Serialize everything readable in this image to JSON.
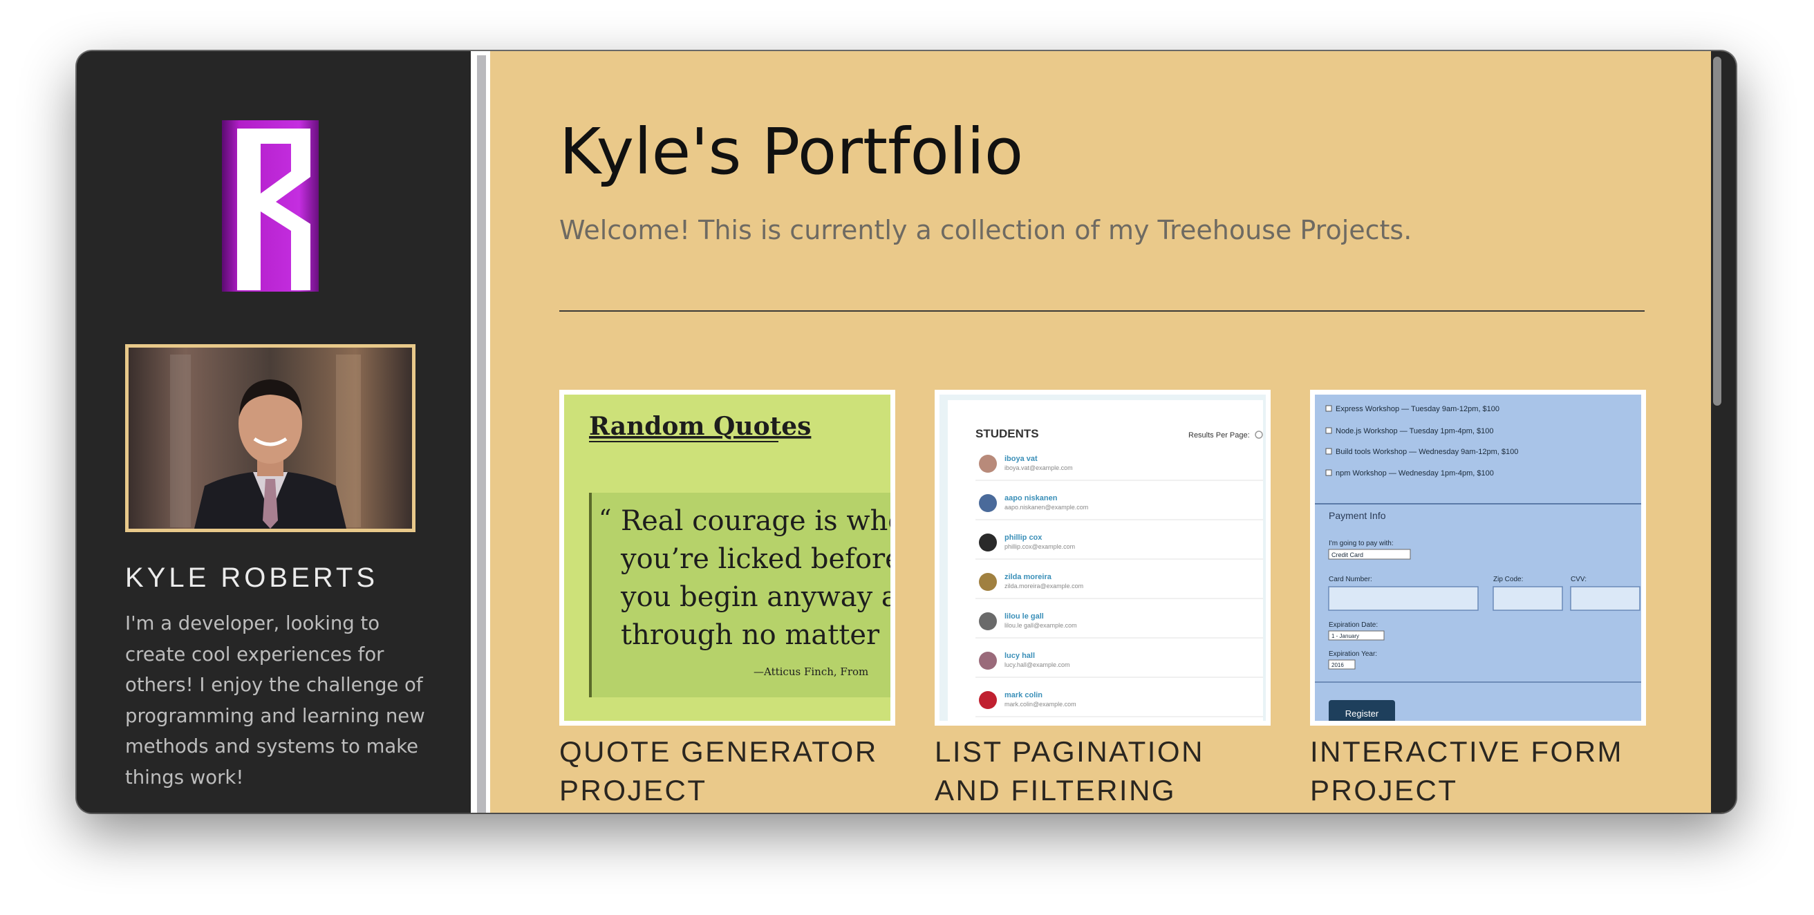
{
  "sidebar": {
    "logo_icon": "kr-monogram-logo",
    "avatar_icon": "profile-photo",
    "name": "KYLE ROBERTS",
    "bio": "I'm a developer, looking to create cool experiences for others! I enjoy the challenge of programming and learning new methods and systems to make things work!"
  },
  "main": {
    "title": "Kyle's Portfolio",
    "subtitle": "Welcome! This is currently a collection of my Treehouse Projects.",
    "projects": [
      {
        "title": "QUOTE GENERATOR PROJECT",
        "thumb": {
          "heading": "Random Quotes",
          "quote_line_1": "Real courage is whe",
          "quote_line_2": "you’re licked before",
          "quote_line_3": "you begin anyway a",
          "quote_line_4": "through no matter",
          "attribution": "—Atticus Finch, From"
        }
      },
      {
        "title": "LIST PAGINATION AND FILTERING PROJECT",
        "thumb": {
          "heading": "STUDENTS",
          "results_label": "Results Per Page:",
          "students": [
            {
              "name": "iboya vat",
              "email": "iboya.vat@example.com"
            },
            {
              "name": "aapo niskanen",
              "email": "aapo.niskanen@example.com"
            },
            {
              "name": "phillip cox",
              "email": "phillip.cox@example.com"
            },
            {
              "name": "zilda moreira",
              "email": "zilda.moreira@example.com"
            },
            {
              "name": "lilou le gall",
              "email": "lilou.le gall@example.com"
            },
            {
              "name": "lucy hall",
              "email": "lucy.hall@example.com"
            },
            {
              "name": "mark colin",
              "email": "mark.colin@example.com"
            }
          ]
        }
      },
      {
        "title": "INTERACTIVE FORM PROJECT",
        "thumb": {
          "workshops": [
            "Express Workshop — Tuesday 9am-12pm, $100",
            "Node.js Workshop — Tuesday 1pm-4pm, $100",
            "Build tools Workshop — Wednesday 9am-12pm, $100",
            "npm Workshop — Wednesday 1pm-4pm, $100"
          ],
          "payment_heading": "Payment Info",
          "pay_with_label": "I'm going to pay with:",
          "pay_with_value": "Credit Card",
          "card_number_label": "Card Number:",
          "zip_label": "Zip Code:",
          "cvv_label": "CVV:",
          "exp_date_label": "Expiration Date:",
          "exp_date_value": "1 - January",
          "exp_year_label": "Expiration Year:",
          "exp_year_value": "2016",
          "register_label": "Register"
        }
      }
    ]
  },
  "colors": {
    "sidebar_bg": "#262626",
    "main_bg": "#eac98a",
    "logo_magenta": "#b21ec8",
    "avatar_border": "#e8c98a"
  }
}
